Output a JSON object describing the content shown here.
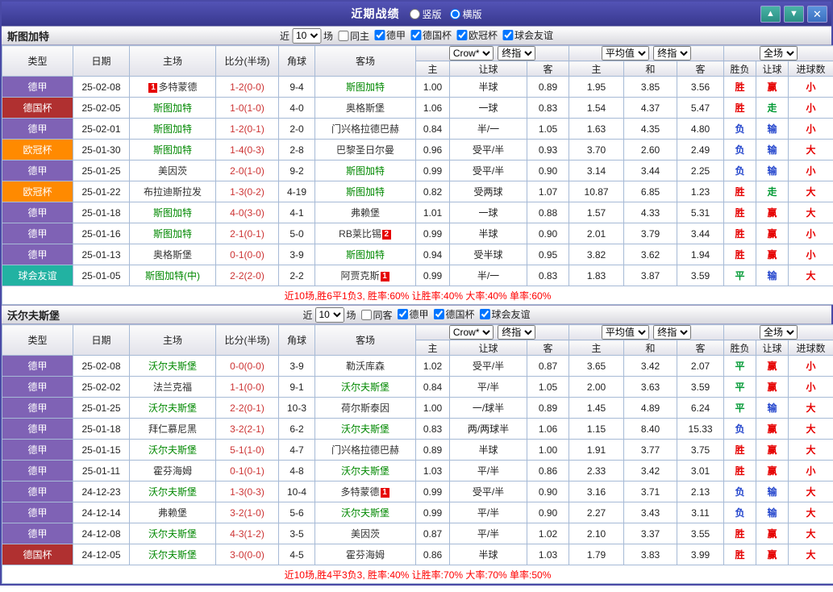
{
  "titlebar": {
    "title": "近期战绩",
    "modes": [
      {
        "label": "竖版",
        "selected": false
      },
      {
        "label": "横版",
        "selected": true
      }
    ]
  },
  "icons": {
    "up": "▲",
    "down": "▼",
    "close": "✕"
  },
  "colors": {
    "focus_team": "#008800",
    "opponent_team": "#333333",
    "score": "#CC3333",
    "summary": "#FF0000",
    "league_colors": {
      "德甲": "#7F62B5",
      "德国杯": "#B03030",
      "欧冠杯": "#FF8A00",
      "球会友谊": "#22B2A2"
    },
    "result_colors": {
      "胜": "#E60000",
      "平": "#009933",
      "负": "#2244CC",
      "赢": "#E60000",
      "走": "#009933",
      "输": "#2244CC",
      "大": "#E60000",
      "小": "#E60000"
    }
  },
  "filter_labels": {
    "near": "近",
    "games": "场",
    "count": "10"
  },
  "table_headers": {
    "col_type": "类型",
    "col_date": "日期",
    "col_home": "主场",
    "col_score": "比分(半场)",
    "col_corner": "角球",
    "col_away": "客场",
    "ah_home": "主",
    "ah_line": "让球",
    "ah_away": "客",
    "eu_home": "主",
    "eu_draw": "和",
    "eu_away": "客",
    "res_wdl": "胜负",
    "res_ah": "让球",
    "res_goals": "进球数",
    "dd_crow": "Crow*",
    "dd_final": "终指",
    "dd_avg": "平均值",
    "dd_full": "全场"
  },
  "sections": [
    {
      "team": "斯图加特",
      "filter": {
        "same_label": "同主",
        "same_checked": false,
        "leagues": [
          {
            "label": "德甲",
            "checked": true
          },
          {
            "label": "德国杯",
            "checked": true
          },
          {
            "label": "欧冠杯",
            "checked": true
          },
          {
            "label": "球会友谊",
            "checked": true
          }
        ]
      },
      "rows": [
        {
          "lg": "德甲",
          "date": "25-02-08",
          "home": "多特蒙德",
          "hb": "1",
          "hbPos": "pre",
          "score": "1-2(0-0)",
          "corner": "9-4",
          "away": "斯图加特",
          "focus": "away",
          "odds": [
            "1.00",
            "半球",
            "0.89",
            "1.95",
            "3.85",
            "3.56"
          ],
          "res": [
            "胜",
            "赢",
            "小"
          ]
        },
        {
          "lg": "德国杯",
          "date": "25-02-05",
          "home": "斯图加特",
          "score": "1-0(1-0)",
          "corner": "4-0",
          "away": "奥格斯堡",
          "focus": "home",
          "odds": [
            "1.06",
            "一球",
            "0.83",
            "1.54",
            "4.37",
            "5.47"
          ],
          "res": [
            "胜",
            "走",
            "小"
          ]
        },
        {
          "lg": "德甲",
          "date": "25-02-01",
          "home": "斯图加特",
          "score": "1-2(0-1)",
          "corner": "2-0",
          "away": "门兴格拉德巴赫",
          "focus": "home",
          "odds": [
            "0.84",
            "半/一",
            "1.05",
            "1.63",
            "4.35",
            "4.80"
          ],
          "res": [
            "负",
            "输",
            "小"
          ]
        },
        {
          "lg": "欧冠杯",
          "date": "25-01-30",
          "home": "斯图加特",
          "score": "1-4(0-3)",
          "corner": "2-8",
          "away": "巴黎圣日尔曼",
          "focus": "home",
          "odds": [
            "0.96",
            "受平/半",
            "0.93",
            "3.70",
            "2.60",
            "2.49"
          ],
          "res": [
            "负",
            "输",
            "大"
          ]
        },
        {
          "lg": "德甲",
          "date": "25-01-25",
          "home": "美因茨",
          "score": "2-0(1-0)",
          "corner": "9-2",
          "away": "斯图加特",
          "focus": "away",
          "odds": [
            "0.99",
            "受平/半",
            "0.90",
            "3.14",
            "3.44",
            "2.25"
          ],
          "res": [
            "负",
            "输",
            "小"
          ]
        },
        {
          "lg": "欧冠杯",
          "date": "25-01-22",
          "home": "布拉迪斯拉发",
          "score": "1-3(0-2)",
          "corner": "4-19",
          "away": "斯图加特",
          "focus": "away",
          "odds": [
            "0.82",
            "受两球",
            "1.07",
            "10.87",
            "6.85",
            "1.23"
          ],
          "res": [
            "胜",
            "走",
            "大"
          ]
        },
        {
          "lg": "德甲",
          "date": "25-01-18",
          "home": "斯图加特",
          "score": "4-0(3-0)",
          "corner": "4-1",
          "away": "弗赖堡",
          "focus": "home",
          "odds": [
            "1.01",
            "一球",
            "0.88",
            "1.57",
            "4.33",
            "5.31"
          ],
          "res": [
            "胜",
            "赢",
            "大"
          ]
        },
        {
          "lg": "德甲",
          "date": "25-01-16",
          "home": "斯图加特",
          "score": "2-1(0-1)",
          "corner": "5-0",
          "away": "RB莱比锡",
          "ab": "2",
          "focus": "home",
          "odds": [
            "0.99",
            "半球",
            "0.90",
            "2.01",
            "3.79",
            "3.44"
          ],
          "res": [
            "胜",
            "赢",
            "小"
          ]
        },
        {
          "lg": "德甲",
          "date": "25-01-13",
          "home": "奥格斯堡",
          "score": "0-1(0-0)",
          "corner": "3-9",
          "away": "斯图加特",
          "focus": "away",
          "odds": [
            "0.94",
            "受半球",
            "0.95",
            "3.82",
            "3.62",
            "1.94"
          ],
          "res": [
            "胜",
            "赢",
            "小"
          ]
        },
        {
          "lg": "球会友谊",
          "date": "25-01-05",
          "home": "斯图加特(中)",
          "score": "2-2(2-0)",
          "corner": "2-2",
          "away": "阿贾克斯",
          "ab": "1",
          "focus": "home",
          "odds": [
            "0.99",
            "半/一",
            "0.83",
            "1.83",
            "3.87",
            "3.59"
          ],
          "res": [
            "平",
            "输",
            "大"
          ]
        }
      ],
      "summary": "近10场,胜6平1负3, 胜率:60% 让胜率:40% 大率:40% 单率:60%"
    },
    {
      "team": "沃尔夫斯堡",
      "filter": {
        "same_label": "同客",
        "same_checked": false,
        "leagues": [
          {
            "label": "德甲",
            "checked": true
          },
          {
            "label": "德国杯",
            "checked": true
          },
          {
            "label": "球会友谊",
            "checked": true
          }
        ]
      },
      "rows": [
        {
          "lg": "德甲",
          "date": "25-02-08",
          "home": "沃尔夫斯堡",
          "score": "0-0(0-0)",
          "corner": "3-9",
          "away": "勒沃库森",
          "focus": "home",
          "odds": [
            "1.02",
            "受平/半",
            "0.87",
            "3.65",
            "3.42",
            "2.07"
          ],
          "res": [
            "平",
            "赢",
            "小"
          ]
        },
        {
          "lg": "德甲",
          "date": "25-02-02",
          "home": "法兰克福",
          "score": "1-1(0-0)",
          "corner": "9-1",
          "away": "沃尔夫斯堡",
          "focus": "away",
          "odds": [
            "0.84",
            "平/半",
            "1.05",
            "2.00",
            "3.63",
            "3.59"
          ],
          "res": [
            "平",
            "赢",
            "小"
          ]
        },
        {
          "lg": "德甲",
          "date": "25-01-25",
          "home": "沃尔夫斯堡",
          "score": "2-2(0-1)",
          "corner": "10-3",
          "away": "荷尔斯泰因",
          "focus": "home",
          "odds": [
            "1.00",
            "一/球半",
            "0.89",
            "1.45",
            "4.89",
            "6.24"
          ],
          "res": [
            "平",
            "输",
            "大"
          ]
        },
        {
          "lg": "德甲",
          "date": "25-01-18",
          "home": "拜仁慕尼黑",
          "score": "3-2(2-1)",
          "corner": "6-2",
          "away": "沃尔夫斯堡",
          "focus": "away",
          "odds": [
            "0.83",
            "两/两球半",
            "1.06",
            "1.15",
            "8.40",
            "15.33"
          ],
          "res": [
            "负",
            "赢",
            "大"
          ]
        },
        {
          "lg": "德甲",
          "date": "25-01-15",
          "home": "沃尔夫斯堡",
          "score": "5-1(1-0)",
          "corner": "4-7",
          "away": "门兴格拉德巴赫",
          "focus": "home",
          "odds": [
            "0.89",
            "半球",
            "1.00",
            "1.91",
            "3.77",
            "3.75"
          ],
          "res": [
            "胜",
            "赢",
            "大"
          ]
        },
        {
          "lg": "德甲",
          "date": "25-01-11",
          "home": "霍芬海姆",
          "score": "0-1(0-1)",
          "corner": "4-8",
          "away": "沃尔夫斯堡",
          "focus": "away",
          "odds": [
            "1.03",
            "平/半",
            "0.86",
            "2.33",
            "3.42",
            "3.01"
          ],
          "res": [
            "胜",
            "赢",
            "小"
          ]
        },
        {
          "lg": "德甲",
          "date": "24-12-23",
          "home": "沃尔夫斯堡",
          "score": "1-3(0-3)",
          "corner": "10-4",
          "away": "多特蒙德",
          "ab": "1",
          "focus": "home",
          "odds": [
            "0.99",
            "受平/半",
            "0.90",
            "3.16",
            "3.71",
            "2.13"
          ],
          "res": [
            "负",
            "输",
            "大"
          ]
        },
        {
          "lg": "德甲",
          "date": "24-12-14",
          "home": "弗赖堡",
          "score": "3-2(1-0)",
          "corner": "5-6",
          "away": "沃尔夫斯堡",
          "focus": "away",
          "odds": [
            "0.99",
            "平/半",
            "0.90",
            "2.27",
            "3.43",
            "3.11"
          ],
          "res": [
            "负",
            "输",
            "大"
          ]
        },
        {
          "lg": "德甲",
          "date": "24-12-08",
          "home": "沃尔夫斯堡",
          "score": "4-3(1-2)",
          "corner": "3-5",
          "away": "美因茨",
          "focus": "home",
          "odds": [
            "0.87",
            "平/半",
            "1.02",
            "2.10",
            "3.37",
            "3.55"
          ],
          "res": [
            "胜",
            "赢",
            "大"
          ]
        },
        {
          "lg": "德国杯",
          "date": "24-12-05",
          "home": "沃尔夫斯堡",
          "score": "3-0(0-0)",
          "corner": "4-5",
          "away": "霍芬海姆",
          "focus": "home",
          "odds": [
            "0.86",
            "半球",
            "1.03",
            "1.79",
            "3.83",
            "3.99"
          ],
          "res": [
            "胜",
            "赢",
            "大"
          ]
        }
      ],
      "summary": "近10场,胜4平3负3, 胜率:40% 让胜率:70% 大率:70% 单率:50%"
    }
  ]
}
